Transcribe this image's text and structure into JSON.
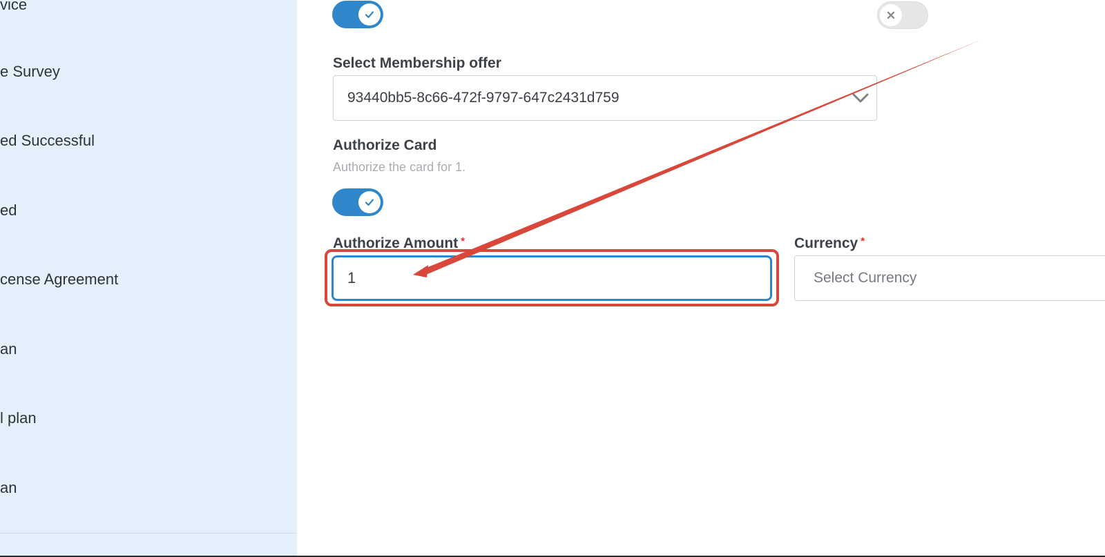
{
  "sidebar": {
    "items": [
      {
        "label": "vice"
      },
      {
        "label": "e Survey"
      },
      {
        "label": "ed Successful"
      },
      {
        "label": "ed"
      },
      {
        "label": "cense Agreement"
      },
      {
        "label": "an"
      },
      {
        "label": "l plan"
      },
      {
        "label": "an"
      }
    ]
  },
  "form": {
    "top_toggle_left": {
      "state": "on",
      "icon": "check-icon"
    },
    "top_toggle_right": {
      "state": "off",
      "icon": "close-icon"
    },
    "membership": {
      "label": "Select Membership offer",
      "selected": "93440bb5-8c66-472f-9797-647c2431d759",
      "icon": "chevron-down-icon"
    },
    "authorize_card": {
      "label": "Authorize Card",
      "help": "Authorize the card for 1.",
      "toggle_state": "on"
    },
    "authorize_amount": {
      "label": "Authorize Amount",
      "required_mark": "*",
      "value": "1"
    },
    "currency": {
      "label": "Currency",
      "required_mark": "*",
      "placeholder": "Select Currency"
    }
  },
  "colors": {
    "sidebar_bg": "#e3f0fc",
    "toggle_on": "#2f86c8",
    "toggle_off": "#e6e6e6",
    "annotation": "#d9473a",
    "required": "#e0322d"
  }
}
